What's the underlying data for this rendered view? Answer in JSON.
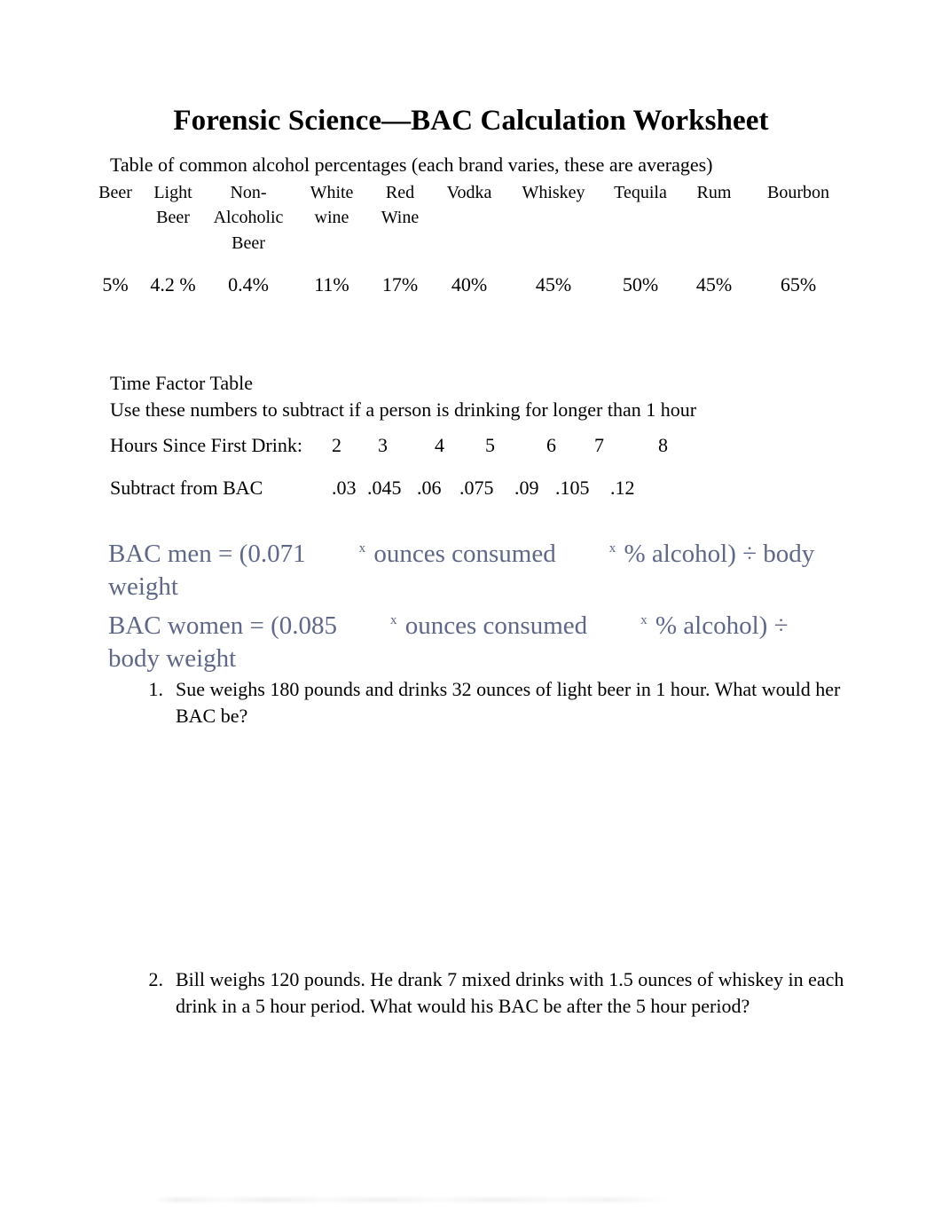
{
  "document": {
    "title": "Forensic Science—BAC Calculation Worksheet"
  },
  "alcohol_table": {
    "caption": "Table of common alcohol percentages (each brand varies, these are averages)",
    "headers": [
      "Beer",
      "Light Beer",
      "Non-Alcoholic Beer",
      "White wine",
      "Red Wine",
      "Vodka",
      "Whiskey",
      "Tequila",
      "Rum",
      "Bourbon"
    ],
    "values": [
      "5%",
      "4.2 %",
      "0.4%",
      "11%",
      "17%",
      "40%",
      "45%",
      "50%",
      "45%",
      "65%"
    ]
  },
  "time_factor_table": {
    "title": "Time Factor Table",
    "subtitle": "Use these numbers to subtract if a person is drinking for longer than 1 hour",
    "hours_label": "Hours Since First Drink:",
    "hours": [
      "2",
      "3",
      "4",
      "5",
      "6",
      "7",
      "8"
    ],
    "subtract_label": "Subtract from BAC",
    "subtract_values": [
      ".03",
      ".045",
      ".06",
      ".075",
      ".09",
      ".105",
      ".12"
    ]
  },
  "formulas": {
    "color": "#5f6887",
    "multiplication_symbol": "x",
    "men": {
      "prefix": "BAC men = (0.071",
      "middle": "ounces consumed",
      "suffix": "% alcohol) ÷ body weight"
    },
    "women": {
      "prefix": "BAC women = (0.085",
      "middle": "ounces consumed",
      "suffix": "% alcohol) ÷ body weight"
    }
  },
  "questions": [
    {
      "number": "1.",
      "text": "Sue weighs 180 pounds and drinks 32 ounces of light beer in 1 hour.  What would her BAC be?"
    },
    {
      "number": "2.",
      "text": "Bill weighs 120 pounds. He drank 7 mixed drinks with 1.5 ounces of whiskey in each drink in a 5 hour period.  What would his BAC be after the 5 hour period?"
    }
  ]
}
